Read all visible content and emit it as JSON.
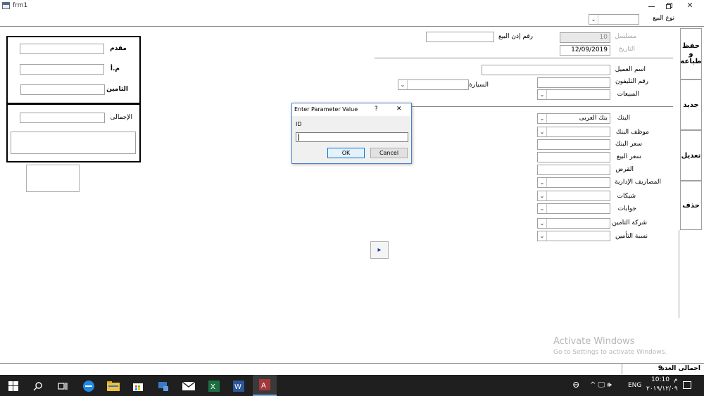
{
  "window": {
    "title": "frm1"
  },
  "header": {
    "sale_type_label": "نوع البيع",
    "sale_type_value": ""
  },
  "main": {
    "serial_label": "مسلسل",
    "serial_value": "10",
    "date_label": "التاريخ",
    "date_value": "12/09/2019",
    "permit_label": "رقم إذن البيع",
    "customer_label": "اسم العميل",
    "phone_label": "رقم التليفون",
    "car_label": "السيارة",
    "sales_label": "المبيعات",
    "bank_label": "البنك",
    "bank_value": "بنك العربى",
    "bank_employee_label": "موظف البنك",
    "bank_price_label": "سعر البنك",
    "sale_price_label": "سعر البيع",
    "loan_label": "القرض",
    "admin_fees_label": "المصاريف الإدارية",
    "cheques_label": "شيكات",
    "bills_label": "جوابات",
    "insurance_company_label": "شركة التامين",
    "insurance_rate_label": "نسبة التأمين",
    "nav_next_symbol": "▸"
  },
  "summary": {
    "down_payment_label": "مقدم",
    "ma_label": "م.أ",
    "insurance_label": "التامين",
    "total_label": "الإجمالى"
  },
  "side_tabs": {
    "save_print": "حفظ و طباعة",
    "new": "جديد",
    "edit": "تعديل",
    "delete": "حذف"
  },
  "footer": {
    "total_count_label": "اجمالى العدد",
    "total_count_value": "9"
  },
  "dialog": {
    "title": "Enter Parameter Value",
    "help_symbol": "?",
    "close_symbol": "✕",
    "param_name": "ID",
    "input_value": "",
    "ok_label": "OK",
    "cancel_label": "Cancel"
  },
  "watermark": {
    "line1": "Activate Windows",
    "line2": "Go to Settings to activate Windows."
  },
  "taskbar": {
    "lang": "ENG",
    "ampm": "م",
    "time": "10:10",
    "date": "٢٠١٩/١٢/٠٩",
    "people_symbol": "Ꮎ",
    "tray_symbols": "^ 🖵 🕪"
  },
  "colors": {
    "accent": "#0078d7",
    "taskbar": "#1f1f1f",
    "tab_border": "#a0a0a0"
  }
}
